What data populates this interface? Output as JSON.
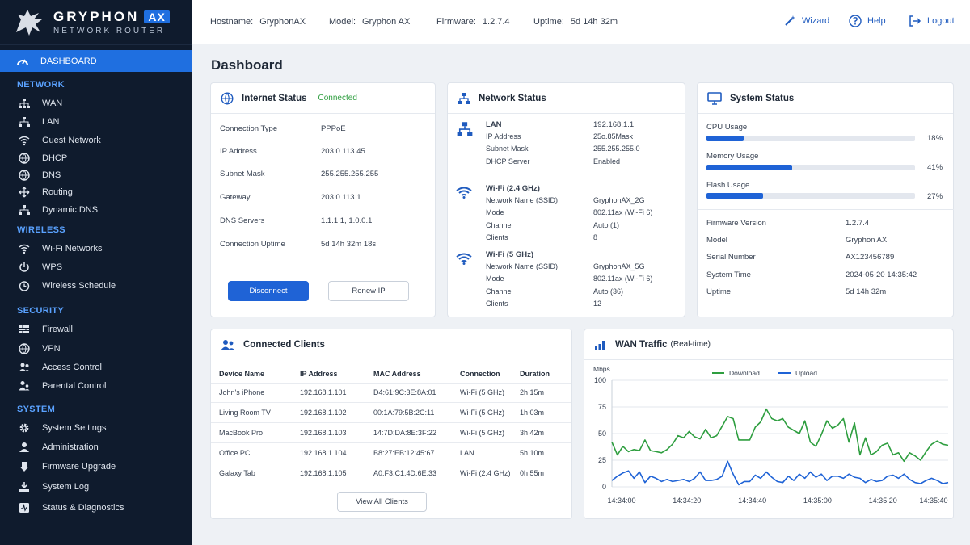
{
  "brand": {
    "name": "GRYPHON",
    "badge": "AX",
    "subtitle": "NETWORK ROUTER"
  },
  "topbar": {
    "hostname_label": "Hostname:",
    "hostname": "GryphonAX",
    "model_label": "Model:",
    "model": "Gryphon AX",
    "firmware_label": "Firmware:",
    "firmware": "1.2.7.4",
    "uptime_label": "Uptime:",
    "uptime": "5d 14h 32m",
    "wizard": "Wizard",
    "help": "Help",
    "logout": "Logout"
  },
  "nav": {
    "dashboard": "DASHBOARD",
    "network": "NETWORK",
    "network_items": [
      "WAN",
      "LAN",
      "Guest Network",
      "DHCP",
      "DNS",
      "Routing",
      "Dynamic DNS"
    ],
    "wireless": "WIRELESS",
    "wireless_items": [
      "Wi-Fi Networks",
      "WPS",
      "Wireless Schedule"
    ],
    "security": "SECURITY",
    "security_items": [
      "Firewall",
      "VPN",
      "Access Control",
      "Parental Control"
    ],
    "system": "SYSTEM",
    "system_items": [
      "System Settings",
      "Administration",
      "Firmware Upgrade",
      "System Log",
      "Status & Diagnostics"
    ]
  },
  "page_title": "Dashboard",
  "internet": {
    "title": "Internet Status",
    "status": "Connected",
    "rows": [
      {
        "label": "Connection Type",
        "value": "PPPoE"
      },
      {
        "label": "IP Address",
        "value": "203.0.113.45"
      },
      {
        "label": "Subnet Mask",
        "value": "255.255.255.255"
      },
      {
        "label": "Gateway",
        "value": "203.0.113.1"
      },
      {
        "label": "DNS Servers",
        "value": "1.1.1.1, 1.0.0.1"
      },
      {
        "label": "Connection Uptime",
        "value": "5d 14h 32m 18s"
      }
    ],
    "disconnect": "Disconnect",
    "renew": "Renew IP"
  },
  "network": {
    "title": "Network Status",
    "lan": {
      "title": "LAN",
      "title_value": "192.168.1.1",
      "rows": [
        [
          "IP Address",
          "25o.85Mask"
        ],
        [
          "Subnet Mask",
          "255.255.255.0"
        ],
        [
          "DHCP Server",
          "Enabled"
        ]
      ]
    },
    "wifi24": {
      "title": "Wi-Fi (2.4 GHz)",
      "rows": [
        [
          "Network Name (SSID)",
          "GryphonAX_2G"
        ],
        [
          "Mode",
          "802.11ax (Wi-Fi 6)"
        ],
        [
          "Channel",
          "Auto (1)"
        ],
        [
          "Clients",
          "8"
        ]
      ]
    },
    "wifi5": {
      "title": "Wi-Fi (5 GHz)",
      "rows": [
        [
          "Network Name (SSID)",
          "GryphonAX_5G"
        ],
        [
          "Mode",
          "802.11ax (Wi-Fi 6)"
        ],
        [
          "Channel",
          "Auto (36)"
        ],
        [
          "Clients",
          "12"
        ]
      ]
    }
  },
  "system": {
    "title": "System Status",
    "usage": [
      {
        "label": "CPU Usage",
        "value": "18%",
        "fraction": 0.18
      },
      {
        "label": "Memory Usage",
        "value": "41%",
        "fraction": 0.41
      },
      {
        "label": "Flash Usage",
        "value": "27%",
        "fraction": 0.27
      }
    ],
    "rows": [
      {
        "label": "Firmware Version",
        "value": "1.2.7.4"
      },
      {
        "label": "Model",
        "value": "Gryphon AX"
      },
      {
        "label": "Serial Number",
        "value": "AX123456789"
      },
      {
        "label": "System Time",
        "value": "2024-05-20 14:35:42"
      },
      {
        "label": "Uptime",
        "value": "5d 14h 32m"
      }
    ]
  },
  "clients": {
    "title": "Connected Clients",
    "headers": [
      "Device Name",
      "IP Address",
      "MAC Address",
      "Connection",
      "Duration"
    ],
    "rows": [
      [
        "John's iPhone",
        "192.168.1.101",
        "D4:61:9C:3E:8A:01",
        "Wi-Fi (5 GHz)",
        "2h 15m"
      ],
      [
        "Living Room TV",
        "192.168.1.102",
        "00:1A:79:5B:2C:11",
        "Wi-Fi (5 GHz)",
        "1h 03m"
      ],
      [
        "MacBook Pro",
        "192.168.1.103",
        "14:7D:DA:8E:3F:22",
        "Wi-Fi (5 GHz)",
        "3h 42m"
      ],
      [
        "Office PC",
        "192.168.1.104",
        "B8:27:EB:12:45:67",
        "LAN",
        "5h 10m"
      ],
      [
        "Galaxy Tab",
        "192.168.1.105",
        "A0:F3:C1:4D:6E:33",
        "Wi-Fi (2.4 GHz)",
        "0h 55m"
      ]
    ],
    "view_all": "View All Clients"
  },
  "wan": {
    "title": "WAN Traffic",
    "subtitle": "(Real-time)"
  },
  "chart_data": {
    "type": "line",
    "ylabel": "Mbps",
    "ylim": [
      0,
      100
    ],
    "yticks": [
      0,
      25,
      50,
      75,
      100
    ],
    "xticks": [
      "14:34:00",
      "14:34:20",
      "14:34:40",
      "14:35:00",
      "14:35:20",
      "14:35:40"
    ],
    "grid": true,
    "legend_position": "top-center",
    "series": [
      {
        "name": "Download",
        "color": "#2e9e3f",
        "values": [
          42,
          30,
          38,
          33,
          35,
          34,
          44,
          34,
          33,
          32,
          35,
          40,
          48,
          46,
          52,
          47,
          45,
          54,
          46,
          48,
          57,
          66,
          64,
          44,
          44,
          44,
          56,
          61,
          73,
          64,
          62,
          64,
          56,
          53,
          50,
          62,
          42,
          38,
          49,
          62,
          55,
          58,
          64,
          42,
          60,
          30,
          46,
          30,
          33,
          39,
          41,
          30,
          32,
          24,
          32,
          29,
          25,
          33,
          40,
          43,
          40,
          39
        ]
      },
      {
        "name": "Upload",
        "color": "#1f63d6",
        "values": [
          6,
          10,
          13,
          15,
          8,
          14,
          4,
          10,
          8,
          5,
          7,
          5,
          6,
          7,
          5,
          8,
          14,
          6,
          6,
          7,
          10,
          24,
          12,
          2,
          5,
          5,
          11,
          8,
          14,
          9,
          5,
          4,
          10,
          6,
          12,
          8,
          14,
          9,
          12,
          6,
          10,
          10,
          8,
          12,
          9,
          8,
          4,
          7,
          5,
          6,
          10,
          11,
          8,
          12,
          7,
          4,
          3,
          6,
          8,
          6,
          3,
          4
        ]
      }
    ]
  },
  "colors": {
    "accent": "#1f63d6",
    "sidebar": "#0f1b2d",
    "connected": "#2e9e3f"
  }
}
